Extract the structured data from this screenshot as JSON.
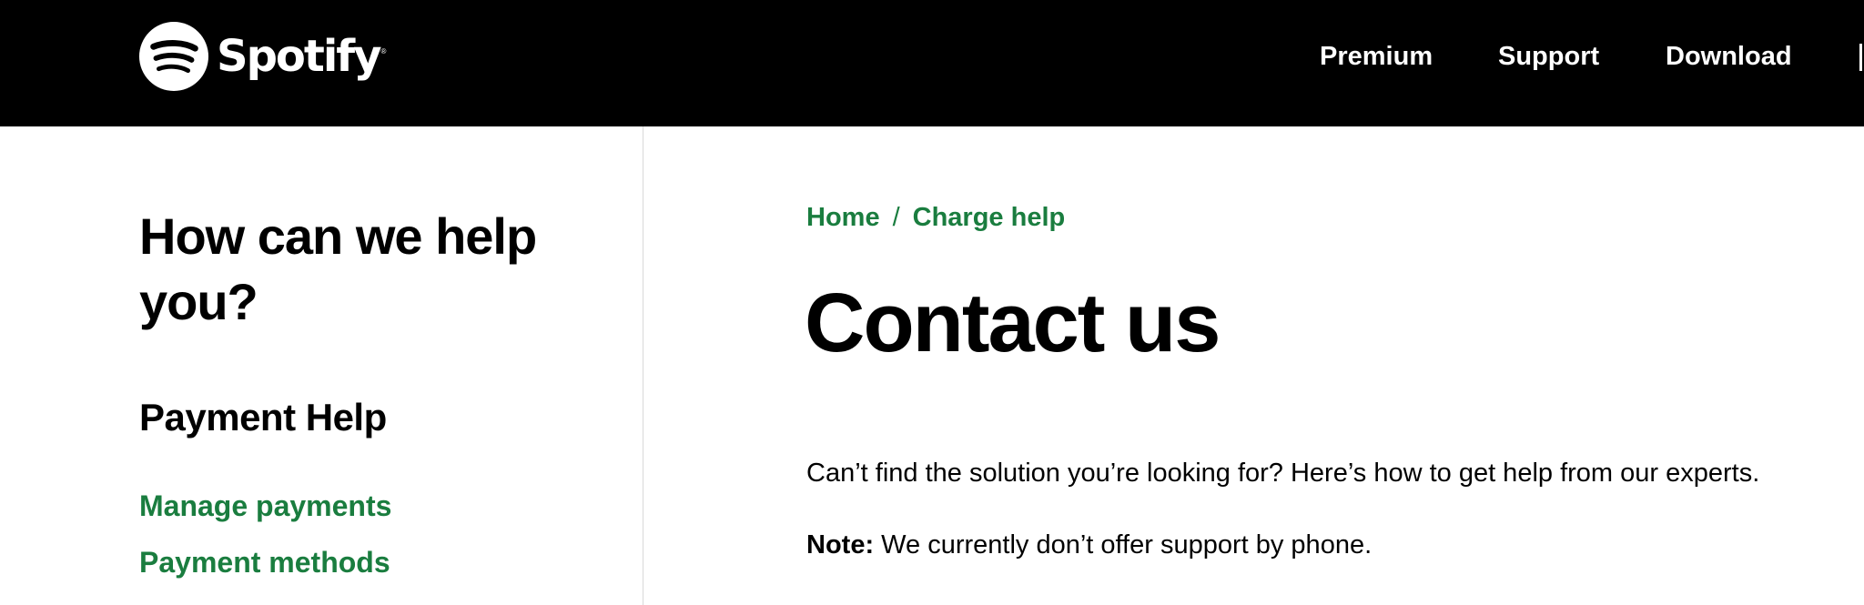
{
  "header": {
    "brand": "Spotify",
    "brand_mark": "®",
    "logo_icon": "spotify-logo-icon",
    "nav": [
      {
        "label": "Premium"
      },
      {
        "label": "Support"
      },
      {
        "label": "Download"
      }
    ]
  },
  "sidebar": {
    "title": "How can we help you?",
    "section_title": "Payment Help",
    "links": [
      {
        "label": "Manage payments"
      },
      {
        "label": "Payment methods"
      }
    ]
  },
  "main": {
    "breadcrumb": [
      {
        "label": "Home"
      },
      {
        "label": "Charge help"
      }
    ],
    "breadcrumb_separator": "/",
    "title": "Contact us",
    "intro": "Can’t find the solution you’re looking for? Here’s how to get help from our experts.",
    "note_label": "Note:",
    "note_text": " We currently don’t offer support by phone."
  },
  "colors": {
    "header_bg": "#000000",
    "link_green": "#1a7d3f",
    "text": "#000000",
    "background": "#ffffff"
  }
}
